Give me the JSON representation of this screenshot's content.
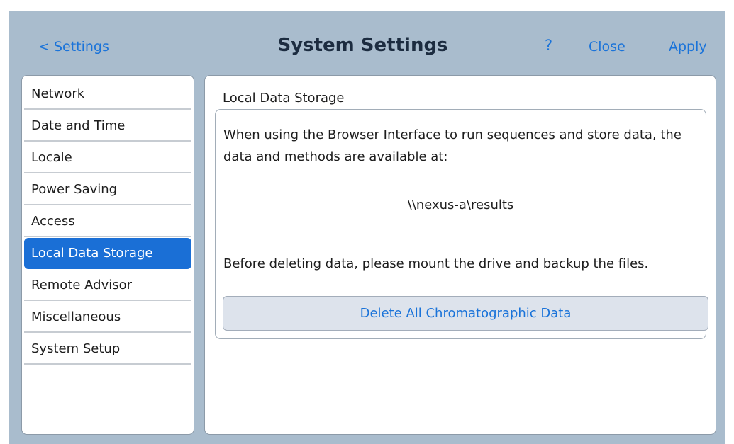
{
  "header": {
    "back_label": "< Settings",
    "title": "System Settings",
    "help_label": "?",
    "close_label": "Close",
    "apply_label": "Apply"
  },
  "sidebar": {
    "items": [
      {
        "label": "Network",
        "active": false
      },
      {
        "label": "Date and Time",
        "active": false
      },
      {
        "label": "Locale",
        "active": false
      },
      {
        "label": "Power Saving",
        "active": false
      },
      {
        "label": "Access",
        "active": false
      },
      {
        "label": "Local Data Storage",
        "active": true
      },
      {
        "label": "Remote Advisor",
        "active": false
      },
      {
        "label": "Miscellaneous",
        "active": false
      },
      {
        "label": "System Setup",
        "active": false
      }
    ]
  },
  "content": {
    "section_title": "Local Data Storage",
    "description": "When using the Browser Interface to run sequences and store data, the data and methods are available at:",
    "path": "\\\\nexus-a\\results",
    "note": "Before deleting data, please mount the drive and backup the files.",
    "delete_button_label": "Delete All Chromatographic Data"
  },
  "colors": {
    "background": "#a9bccd",
    "accent": "#1a73d9",
    "active_item": "#1a6fd6",
    "button_bg": "#dde3ec"
  }
}
